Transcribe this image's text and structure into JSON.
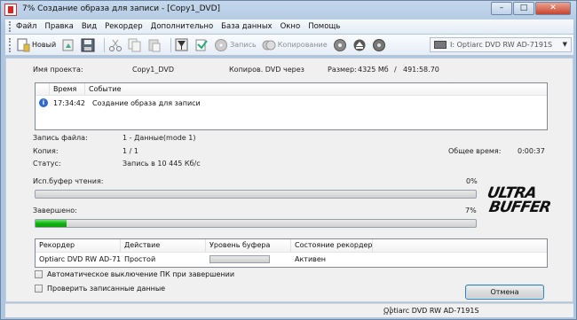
{
  "window": {
    "title": "7% Создание образа для записи - [Copy1_DVD]",
    "minimize": "–",
    "maximize": "□",
    "close": "✕"
  },
  "menu": [
    {
      "label": "Файл"
    },
    {
      "label": "Правка"
    },
    {
      "label": "Вид"
    },
    {
      "label": "Рекордер"
    },
    {
      "label": "Дополнительно"
    },
    {
      "label": "База данных"
    },
    {
      "label": "Окно"
    },
    {
      "label": "Помощь"
    }
  ],
  "toolbar": {
    "new_label": "Новый",
    "burn_label": "Запись",
    "copy_label": "Копирование",
    "drive_select": "I: Optiarc DVD RW AD-7191S"
  },
  "project": {
    "name_label": "Имя проекта:",
    "name_value": "Copy1_DVD",
    "copy_via_label": "Копиров. DVD через",
    "size_label": "Размер:",
    "size_value": "4325 Мб",
    "size_time": "491:58.70"
  },
  "log": {
    "col_time": "Время",
    "col_event": "Событие",
    "rows": [
      {
        "time": "17:34:42",
        "event": "Создание образа для записи"
      }
    ]
  },
  "details": {
    "file_label": "Запись файла:",
    "file_value": "1 - Данные(mode 1)",
    "copy_label": "Копия:",
    "copy_value": "1 / 1",
    "total_time_label": "Общее время:",
    "total_time_value": "0:00:37",
    "status_label": "Статус:",
    "status_value": "Запись в 10 445 Кб/с"
  },
  "read_buffer": {
    "label": "Исп.буфер чтения:",
    "percent_text": "0%",
    "fraction": 0.0
  },
  "completed": {
    "label": "Завершено:",
    "percent_text": "7%",
    "fraction": 0.07
  },
  "logo": {
    "line1": "ULTRA",
    "line2": "BUFFER"
  },
  "recorders": {
    "col_recorder": "Рекордер",
    "col_action": "Действие",
    "col_buffer": "Уровень буфера",
    "col_state": "Состояние рекордер...",
    "rows": [
      {
        "recorder": "Optiarc DVD RW AD-71...",
        "action": "Простой",
        "state": "Активен"
      }
    ]
  },
  "options": {
    "auto_shutdown": "Автоматическое выключение ПК при завершении",
    "verify": "Проверить записанные данные"
  },
  "cancel_label": "Отмена",
  "statusbar": {
    "drive": "Optiarc DVD RW AD-7191S"
  },
  "colors": {
    "progress_green": "#11b311",
    "info_blue": "#2f6bc6"
  }
}
